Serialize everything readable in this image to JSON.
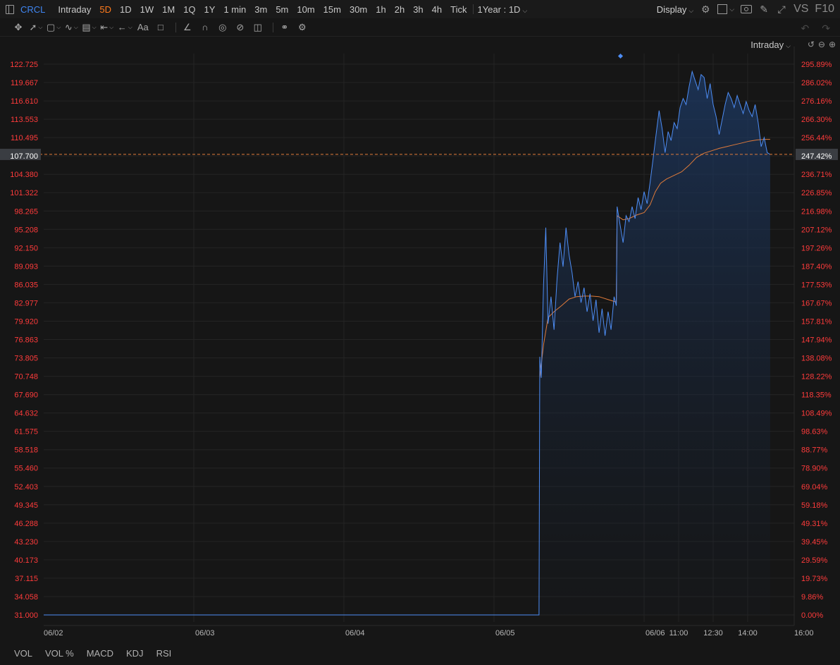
{
  "header": {
    "ticker": "CRCL",
    "timeframes": [
      "Intraday",
      "5D",
      "1D",
      "1W",
      "1M",
      "1Q",
      "1Y",
      "1 min",
      "3m",
      "5m",
      "10m",
      "15m",
      "30m",
      "1h",
      "2h",
      "3h",
      "4h",
      "Tick"
    ],
    "active_timeframe": "5D",
    "range_label": "1Year : 1D",
    "display_label": "Display",
    "vs_label": "VS",
    "f10_label": "F10"
  },
  "mode_selector": {
    "label": "Intraday"
  },
  "colors": {
    "price_line": "#4d8df5",
    "avg_line": "#e07b3a",
    "axis_red": "#ff3b3b",
    "active": "#ff7b1c",
    "current_price_bg": "#3a3d42"
  },
  "icons": [
    "panel-icon",
    "crosshair-icon",
    "trendline-icon",
    "rectangle-icon",
    "wave-icon",
    "fib-icon",
    "measure-icon",
    "arrow-icon",
    "text-icon",
    "comment-icon",
    "eraser-line-icon",
    "magnet-icon",
    "eye-icon",
    "hide-icon",
    "trash-icon",
    "link-icon",
    "gear-icon",
    "undo-icon",
    "redo-icon",
    "camera-icon",
    "pen-icon",
    "expand-icon"
  ],
  "chart_data": {
    "type": "line",
    "y_ticks": [
      "122.725",
      "119.667",
      "116.610",
      "113.553",
      "110.495",
      "107.700",
      "104.380",
      "101.322",
      "98.265",
      "95.208",
      "92.150",
      "89.093",
      "86.035",
      "82.977",
      "79.920",
      "76.863",
      "73.805",
      "70.748",
      "67.690",
      "64.632",
      "61.575",
      "58.518",
      "55.460",
      "52.403",
      "49.345",
      "46.288",
      "43.230",
      "40.173",
      "37.115",
      "34.058",
      "31.000"
    ],
    "pct_ticks": [
      "295.89%",
      "286.02%",
      "276.16%",
      "266.30%",
      "256.44%",
      "247.42%",
      "236.71%",
      "226.85%",
      "216.98%",
      "207.12%",
      "197.26%",
      "187.40%",
      "177.53%",
      "167.67%",
      "157.81%",
      "147.94%",
      "138.08%",
      "128.22%",
      "118.35%",
      "108.49%",
      "98.63%",
      "88.77%",
      "78.90%",
      "69.04%",
      "59.18%",
      "49.31%",
      "39.45%",
      "29.59%",
      "19.73%",
      "9.86%",
      "0.00%"
    ],
    "ylim": [
      31.0,
      122.725
    ],
    "current_price": 107.7,
    "current_pct": "247.42%",
    "x_labels": [
      "06/02",
      "06/03",
      "06/04",
      "06/05",
      "06/06",
      "11:00",
      "12:30",
      "14:00",
      "16:00"
    ],
    "series": [
      {
        "values": [
          [
            0,
            31.0
          ],
          [
            0.66,
            31.0
          ],
          [
            0.661,
            74.0
          ],
          [
            0.663,
            70.5
          ],
          [
            0.666,
            86.0
          ],
          [
            0.669,
            95.5
          ],
          [
            0.672,
            79.5
          ],
          [
            0.676,
            84.0
          ],
          [
            0.68,
            78.5
          ],
          [
            0.684,
            87.0
          ],
          [
            0.688,
            93.0
          ],
          [
            0.692,
            89.0
          ],
          [
            0.696,
            95.5
          ],
          [
            0.7,
            91.0
          ],
          [
            0.704,
            88.0
          ],
          [
            0.708,
            84.0
          ],
          [
            0.712,
            86.5
          ],
          [
            0.716,
            83.0
          ],
          [
            0.72,
            85.5
          ],
          [
            0.724,
            81.5
          ],
          [
            0.728,
            84.5
          ],
          [
            0.732,
            80.0
          ],
          [
            0.736,
            83.5
          ],
          [
            0.74,
            78.0
          ],
          [
            0.744,
            82.0
          ],
          [
            0.748,
            77.5
          ],
          [
            0.752,
            81.5
          ],
          [
            0.756,
            78.5
          ],
          [
            0.76,
            84.0
          ],
          [
            0.763,
            82.5
          ],
          [
            0.764,
            99.0
          ],
          [
            0.768,
            96.0
          ],
          [
            0.772,
            93.0
          ],
          [
            0.776,
            97.5
          ],
          [
            0.78,
            96.5
          ],
          [
            0.784,
            99.0
          ],
          [
            0.788,
            97.0
          ],
          [
            0.792,
            100.5
          ],
          [
            0.796,
            98.5
          ],
          [
            0.8,
            101.5
          ],
          [
            0.804,
            99.5
          ],
          [
            0.808,
            103.0
          ],
          [
            0.812,
            107.0
          ],
          [
            0.816,
            111.0
          ],
          [
            0.82,
            115.0
          ],
          [
            0.824,
            112.0
          ],
          [
            0.828,
            108.0
          ],
          [
            0.832,
            111.5
          ],
          [
            0.836,
            110.0
          ],
          [
            0.84,
            113.0
          ],
          [
            0.844,
            112.0
          ],
          [
            0.848,
            115.5
          ],
          [
            0.852,
            117.0
          ],
          [
            0.856,
            116.0
          ],
          [
            0.86,
            119.0
          ],
          [
            0.864,
            121.5
          ],
          [
            0.868,
            120.0
          ],
          [
            0.872,
            118.5
          ],
          [
            0.876,
            121.0
          ],
          [
            0.88,
            120.5
          ],
          [
            0.884,
            117.0
          ],
          [
            0.888,
            119.5
          ],
          [
            0.892,
            116.0
          ],
          [
            0.896,
            114.0
          ],
          [
            0.9,
            111.0
          ],
          [
            0.904,
            113.5
          ],
          [
            0.908,
            116.0
          ],
          [
            0.912,
            118.0
          ],
          [
            0.916,
            117.0
          ],
          [
            0.92,
            115.5
          ],
          [
            0.924,
            117.5
          ],
          [
            0.928,
            116.0
          ],
          [
            0.932,
            114.5
          ],
          [
            0.936,
            116.5
          ],
          [
            0.94,
            115.0
          ],
          [
            0.944,
            114.0
          ],
          [
            0.948,
            116.0
          ],
          [
            0.952,
            113.0
          ],
          [
            0.956,
            109.0
          ],
          [
            0.96,
            110.5
          ],
          [
            0.964,
            108.0
          ],
          [
            0.968,
            107.7
          ]
        ]
      },
      {
        "values": [
          [
            0.661,
            70.5
          ],
          [
            0.666,
            76.0
          ],
          [
            0.672,
            80.5
          ],
          [
            0.68,
            81.5
          ],
          [
            0.69,
            82.5
          ],
          [
            0.7,
            83.6
          ],
          [
            0.71,
            84.0
          ],
          [
            0.72,
            84.1
          ],
          [
            0.73,
            84.1
          ],
          [
            0.74,
            84.0
          ],
          [
            0.75,
            83.6
          ],
          [
            0.763,
            83.1
          ],
          [
            0.764,
            97.5
          ],
          [
            0.772,
            96.8
          ],
          [
            0.78,
            97.0
          ],
          [
            0.79,
            97.6
          ],
          [
            0.8,
            98.0
          ],
          [
            0.808,
            99.3
          ],
          [
            0.815,
            101.5
          ],
          [
            0.822,
            102.9
          ],
          [
            0.83,
            103.6
          ],
          [
            0.84,
            104.2
          ],
          [
            0.85,
            104.8
          ],
          [
            0.86,
            105.9
          ],
          [
            0.87,
            107.2
          ],
          [
            0.88,
            107.9
          ],
          [
            0.89,
            108.3
          ],
          [
            0.9,
            108.7
          ],
          [
            0.91,
            109.0
          ],
          [
            0.92,
            109.3
          ],
          [
            0.93,
            109.6
          ],
          [
            0.94,
            109.9
          ],
          [
            0.95,
            110.1
          ],
          [
            0.96,
            110.2
          ],
          [
            0.968,
            110.2
          ]
        ]
      }
    ],
    "grid": true
  },
  "bottom": {
    "indicators": [
      "VOL",
      "VOL %",
      "MACD",
      "KDJ",
      "RSI"
    ]
  }
}
